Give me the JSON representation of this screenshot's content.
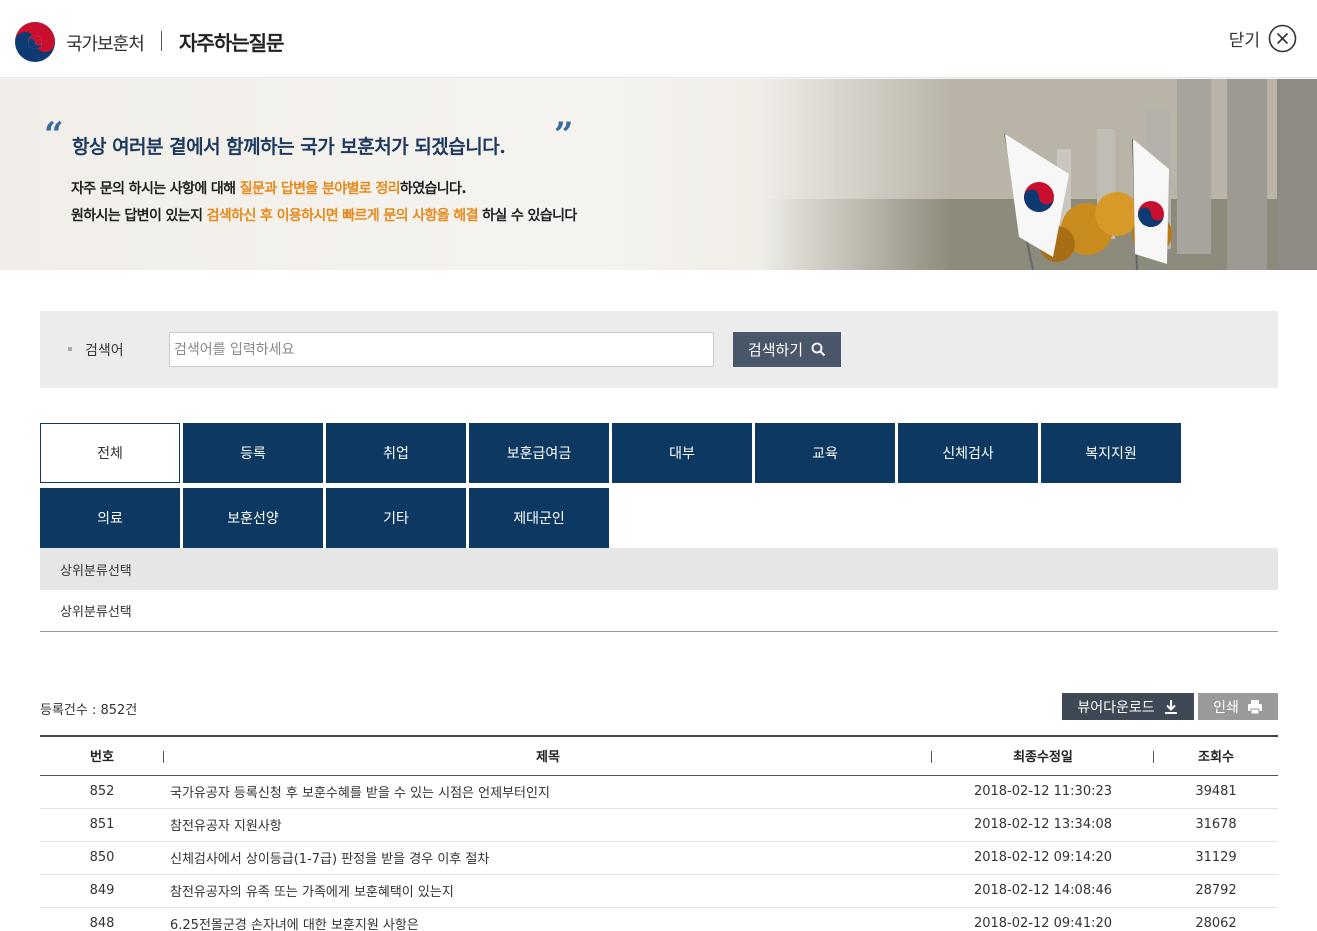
{
  "header": {
    "org_name": "국가보훈처",
    "page_title": "자주하는질문",
    "close_label": "닫기"
  },
  "banner": {
    "quote_open": "“",
    "quote_close": "”",
    "slogan": "항상 여러분 곁에서 함께하는 국가 보훈처가 되겠습니다.",
    "line1_a": "자주 문의 하시는 사항에 대해 ",
    "line1_hl": "질문과 답변을 분야별로 정리",
    "line1_b": "하였습니다.",
    "line2_a": "원하시는 답변이 있는지 ",
    "line2_hl": "검색하신 후 이용하시면 빠르게 문의 사항을 해결",
    "line2_b": " 하실 수 있습니다"
  },
  "search": {
    "label": "검색어",
    "placeholder": "검색어를 입력하세요",
    "button_label": "검색하기"
  },
  "categories": [
    {
      "label": "전체",
      "active": true
    },
    {
      "label": "등록"
    },
    {
      "label": "취업"
    },
    {
      "label": "보훈급여금"
    },
    {
      "label": "대부"
    },
    {
      "label": "교육"
    },
    {
      "label": "신체검사"
    },
    {
      "label": "복지지원"
    },
    {
      "label": "의료"
    },
    {
      "label": "보훈선양"
    },
    {
      "label": "기타"
    },
    {
      "label": "제대군인"
    }
  ],
  "subcategory": {
    "row1": "상위분류선택",
    "row2": "상위분류선택"
  },
  "list": {
    "count_label": "등록건수 : 852건",
    "download_label": "뷰어다운로드",
    "print_label": "인쇄",
    "columns": {
      "no": "번호",
      "title": "제목",
      "date": "최종수정일",
      "views": "조회수"
    },
    "rows": [
      {
        "no": "852",
        "title": "국가유공자 등록신청 후 보훈수혜를 받을 수 있는 시점은 언제부터인지",
        "date": "2018-02-12 11:30:23",
        "views": "39481"
      },
      {
        "no": "851",
        "title": "참전유공자 지원사항",
        "date": "2018-02-12 13:34:08",
        "views": "31678"
      },
      {
        "no": "850",
        "title": "신체검사에서 상이등급(1-7급) 판정을 받을 경우 이후 절차",
        "date": "2018-02-12 09:14:20",
        "views": "31129"
      },
      {
        "no": "849",
        "title": "참전유공자의 유족 또는 가족에게 보훈혜택이 있는지",
        "date": "2018-02-12 14:08:46",
        "views": "28792"
      },
      {
        "no": "848",
        "title": "6.25전몰군경 손자녀에 대한 보훈지원 사항은",
        "date": "2018-02-12 09:41:20",
        "views": "28062"
      }
    ]
  },
  "colors": {
    "navy": "#0d3862",
    "accent_orange": "#e68a1c",
    "search_button": "#4a5669"
  }
}
